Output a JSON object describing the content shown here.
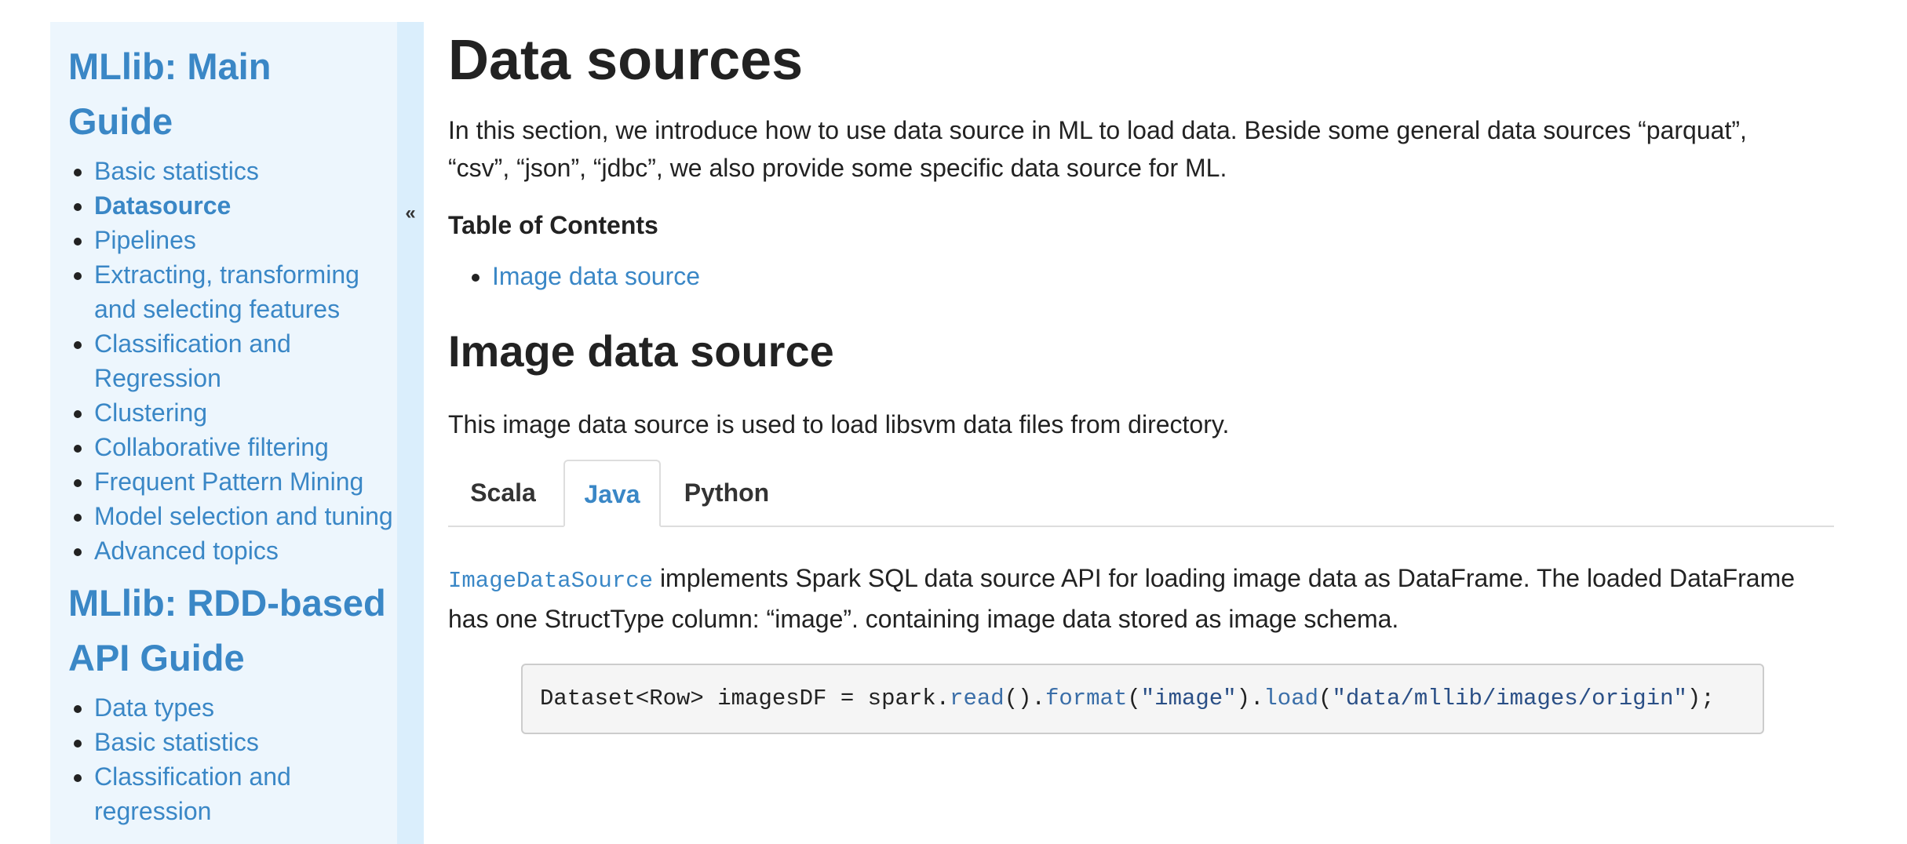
{
  "sidebar": {
    "collapse_symbol": "«",
    "main_guide": {
      "heading_line1": "MLlib: Main",
      "heading_line2": "Guide",
      "items": [
        {
          "label": "Basic statistics",
          "active": false
        },
        {
          "label": "Datasource",
          "active": true
        },
        {
          "label": "Pipelines",
          "active": false
        },
        {
          "label": "Extracting, transforming and selecting features",
          "active": false
        },
        {
          "label": "Classification and Regression",
          "active": false
        },
        {
          "label": "Clustering",
          "active": false
        },
        {
          "label": "Collaborative filtering",
          "active": false
        },
        {
          "label": "Frequent Pattern Mining",
          "active": false
        },
        {
          "label": "Model selection and tuning",
          "active": false
        },
        {
          "label": "Advanced topics",
          "active": false
        }
      ]
    },
    "rdd_guide": {
      "heading_line1": "MLlib: RDD-based",
      "heading_line2": "API Guide",
      "items": [
        {
          "label": "Data types"
        },
        {
          "label": "Basic statistics"
        },
        {
          "label": "Classification and regression"
        }
      ]
    }
  },
  "main": {
    "title": "Data sources",
    "intro": "In this section, we introduce how to use data source in ML to load data. Beside some general data sources “parquat”, “csv”, “json”, “jdbc”, we also provide some specific data source for ML.",
    "toc_title": "Table of Contents",
    "toc_items": [
      "Image data source"
    ],
    "section_title": "Image data source",
    "section_desc": "This image data source is used to load libsvm data files from directory.",
    "tabs": [
      {
        "label": "Scala",
        "active": false
      },
      {
        "label": "Java",
        "active": true
      },
      {
        "label": "Python",
        "active": false
      }
    ],
    "api_class": "ImageDataSource",
    "api_desc": " implements Spark SQL data source API for loading image data as DataFrame. The loaded DataFrame has one StructType column: “image”. containing image data stored as image schema.",
    "code": {
      "p1": "Dataset<Row> imagesDF = spark.",
      "read": "read",
      "p2": "().",
      "format": "format",
      "p3": "(",
      "s1": "\"image\"",
      "p4": ").",
      "load": "load",
      "p5": "(",
      "s2": "\"data/mllib/images/origin\"",
      "p6": ");"
    }
  },
  "colors": {
    "link": "#3a87c6",
    "sidebar_bg": "#edf6fd",
    "collapse_bg": "#daeefc",
    "code_bg": "#f5f5f5"
  }
}
